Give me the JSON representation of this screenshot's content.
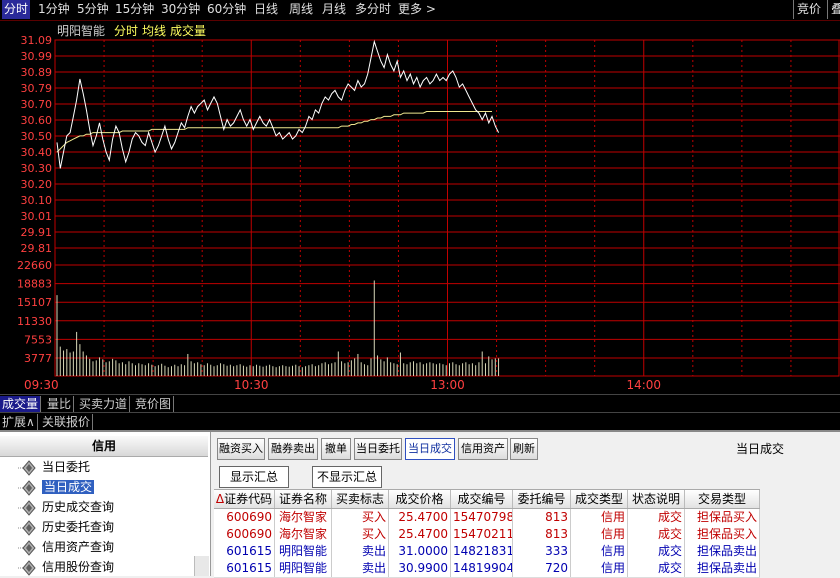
{
  "toolbar": {
    "periods": [
      "分时",
      "1分钟",
      "5分钟",
      "15分钟",
      "30分钟",
      "60分钟",
      "日线",
      "周线",
      "月线",
      "多分时",
      "更多 >"
    ],
    "active": "分时",
    "right_items": [
      "竞价",
      "叠"
    ]
  },
  "legend": {
    "stock_name": "明阳智能",
    "mode": "分时",
    "avg_label": "均线",
    "vol_label": "成交量"
  },
  "chart_data": {
    "type": "line",
    "price_ticks": [
      "31.09",
      "30.99",
      "30.89",
      "30.79",
      "30.70",
      "30.60",
      "30.50",
      "30.40",
      "30.30",
      "30.20",
      "30.10",
      "30.01",
      "29.91",
      "29.81"
    ],
    "volume_ticks": [
      "22660",
      "18883",
      "15107",
      "11330",
      "7553",
      "3777"
    ],
    "time_ticks": [
      "09:30",
      "10:30",
      "13:00",
      "14:00"
    ],
    "ylim": [
      29.81,
      31.09
    ],
    "volume_ylim": [
      0,
      22660
    ],
    "minutes_total": 240,
    "grid": true,
    "price": [
      30.46,
      30.3,
      30.4,
      30.5,
      30.52,
      30.62,
      30.72,
      30.85,
      30.76,
      30.66,
      30.54,
      30.44,
      30.5,
      30.58,
      30.48,
      30.4,
      30.35,
      30.48,
      30.56,
      30.52,
      30.42,
      30.34,
      30.4,
      30.48,
      30.52,
      30.5,
      30.46,
      30.44,
      30.52,
      30.46,
      30.4,
      30.44,
      30.5,
      30.56,
      30.48,
      30.42,
      30.46,
      30.52,
      30.58,
      30.55,
      30.62,
      30.68,
      30.64,
      30.68,
      30.7,
      30.72,
      30.66,
      30.7,
      30.74,
      30.7,
      30.62,
      30.54,
      30.6,
      30.56,
      30.58,
      30.62,
      30.66,
      30.6,
      30.56,
      30.6,
      30.54,
      30.58,
      30.62,
      30.58,
      30.56,
      30.6,
      30.55,
      30.5,
      30.52,
      30.48,
      30.5,
      30.52,
      30.48,
      30.5,
      30.54,
      30.52,
      30.56,
      30.62,
      30.6,
      30.66,
      30.64,
      30.7,
      30.74,
      30.72,
      30.76,
      30.78,
      30.74,
      30.72,
      30.78,
      30.82,
      30.8,
      30.78,
      30.84,
      30.8,
      30.82,
      30.88,
      30.98,
      31.08,
      31.02,
      30.96,
      30.92,
      31.0,
      30.94,
      30.9,
      30.96,
      30.86,
      30.9,
      30.84,
      30.88,
      30.82,
      30.86,
      30.8,
      30.84,
      30.86,
      30.82,
      30.84,
      30.88,
      30.84,
      30.86,
      30.84,
      30.88,
      30.9,
      30.86,
      30.8,
      30.82,
      30.78,
      30.74,
      30.7,
      30.66,
      30.64,
      30.6,
      30.64,
      30.58,
      30.62,
      30.56,
      30.52
    ],
    "avg": [
      30.4,
      30.42,
      30.44,
      30.46,
      30.47,
      30.48,
      30.49,
      30.5,
      30.5,
      30.51,
      30.51,
      30.52,
      30.52,
      30.52,
      30.52,
      30.52,
      30.52,
      30.52,
      30.52,
      30.52,
      30.53,
      30.53,
      30.53,
      30.53,
      30.53,
      30.53,
      30.53,
      30.53,
      30.53,
      30.54,
      30.54,
      30.54,
      30.54,
      30.54,
      30.54,
      30.54,
      30.54,
      30.54,
      30.54,
      30.54,
      30.55,
      30.55,
      30.55,
      30.55,
      30.55,
      30.55,
      30.55,
      30.55,
      30.55,
      30.55,
      30.55,
      30.55,
      30.55,
      30.55,
      30.55,
      30.55,
      30.55,
      30.55,
      30.55,
      30.55,
      30.55,
      30.55,
      30.55,
      30.55,
      30.55,
      30.55,
      30.55,
      30.55,
      30.55,
      30.55,
      30.55,
      30.55,
      30.55,
      30.55,
      30.55,
      30.55,
      30.55,
      30.55,
      30.55,
      30.55,
      30.55,
      30.55,
      30.55,
      30.55,
      30.55,
      30.55,
      30.55,
      30.56,
      30.56,
      30.56,
      30.57,
      30.57,
      30.58,
      30.58,
      30.59,
      30.59,
      30.6,
      30.6,
      30.61,
      30.61,
      30.62,
      30.62,
      30.62,
      30.63,
      30.63,
      30.63,
      30.64,
      30.64,
      30.64,
      30.64,
      30.64,
      30.64,
      30.64,
      30.65,
      30.65,
      30.65,
      30.65,
      30.65,
      30.65,
      30.65,
      30.65,
      30.65,
      30.65,
      30.65,
      30.65,
      30.65,
      30.65,
      30.65,
      30.65,
      30.65,
      30.65,
      30.65,
      30.65,
      30.65
    ],
    "volume": [
      16500,
      6000,
      5200,
      5500,
      4800,
      5000,
      9000,
      6500,
      5000,
      4200,
      3500,
      3000,
      3200,
      3800,
      3400,
      2800,
      3000,
      3500,
      3200,
      2600,
      2800,
      2400,
      3000,
      2600,
      2200,
      2600,
      2400,
      2200,
      2600,
      2300,
      2000,
      2200,
      2500,
      2100,
      1800,
      2000,
      2300,
      2000,
      2400,
      2200,
      4500,
      3000,
      2600,
      2800,
      2400,
      2200,
      2600,
      2300,
      2000,
      2200,
      2600,
      2400,
      2100,
      2300,
      2000,
      2200,
      2400,
      2100,
      1900,
      2200,
      2000,
      2300,
      2100,
      1900,
      2100,
      2300,
      2000,
      1800,
      2000,
      2200,
      2000,
      1900,
      2100,
      2300,
      2000,
      1800,
      2000,
      2200,
      2400,
      2000,
      2200,
      2600,
      2800,
      2400,
      2600,
      2800,
      5000,
      3000,
      2600,
      2800,
      3200,
      3600,
      4500,
      2800,
      2400,
      2200,
      3600,
      19500,
      4200,
      3400,
      3000,
      3800,
      2800,
      2600,
      2400,
      4800,
      2600,
      2400,
      2800,
      3000,
      2600,
      2800,
      2400,
      2600,
      2800,
      2600,
      2400,
      2600,
      2400,
      2200,
      2600,
      2800,
      2400,
      2200,
      2600,
      2800,
      2400,
      2600,
      2200,
      2800,
      5000,
      2600,
      4000,
      3400,
      3600,
      3600
    ]
  },
  "indicator_tabs": [
    "成交量",
    "量比",
    "买卖力道",
    "竞价图"
  ],
  "active_indicator": "成交量",
  "ext_tabs": [
    "扩展∧",
    "关联报价"
  ],
  "left_panel": {
    "title": "信用",
    "items": [
      "当日委托",
      "当日成交",
      "历史成交查询",
      "历史委托查询",
      "信用资产查询",
      "信用股份查询"
    ],
    "selected": "当日成交"
  },
  "right_toolbar": {
    "buttons": [
      "融资买入",
      "融券卖出",
      "撤单",
      "当日委托",
      "当日成交",
      "信用资产",
      "刷新"
    ],
    "active": "当日成交",
    "title": "当日成交"
  },
  "summary_buttons": {
    "show": "显示汇总",
    "hide": "不显示汇总"
  },
  "table": {
    "headers": [
      "证券代码",
      "证券名称",
      "买卖标志",
      "成交价格",
      "成交编号",
      "委托编号",
      "成交类型",
      "状态说明",
      "交易类型"
    ],
    "sort_marker": "Δ",
    "rows": [
      {
        "code": "600690",
        "name": "海尔智家",
        "side": "买入",
        "price": "25.4700",
        "trade_no": "15470798",
        "order_no": "813",
        "type": "信用",
        "status": "成交",
        "trade_type": "担保品买入",
        "color": "#c00000"
      },
      {
        "code": "600690",
        "name": "海尔智家",
        "side": "买入",
        "price": "25.4700",
        "trade_no": "15470211",
        "order_no": "813",
        "type": "信用",
        "status": "成交",
        "trade_type": "担保品买入",
        "color": "#c00000"
      },
      {
        "code": "601615",
        "name": "明阳智能",
        "side": "卖出",
        "price": "31.0000",
        "trade_no": "14821831",
        "order_no": "333",
        "type": "信用",
        "status": "成交",
        "trade_type": "担保品卖出",
        "color": "#0000b0"
      },
      {
        "code": "601615",
        "name": "明阳智能",
        "side": "卖出",
        "price": "30.9900",
        "trade_no": "14819904",
        "order_no": "720",
        "type": "信用",
        "status": "成交",
        "trade_type": "担保品卖出",
        "color": "#0000b0"
      }
    ]
  },
  "colors": {
    "grid": "#c00000",
    "price_line": "#ffffff",
    "avg_line": "#f0e890",
    "volume_bar": "#d8d8b8",
    "axis_text": "#ff4040",
    "buy_text": "#c00000",
    "sell_text": "#0000b0",
    "legend_name": "#d0d0d0",
    "legend_mode": "#ffff60"
  }
}
